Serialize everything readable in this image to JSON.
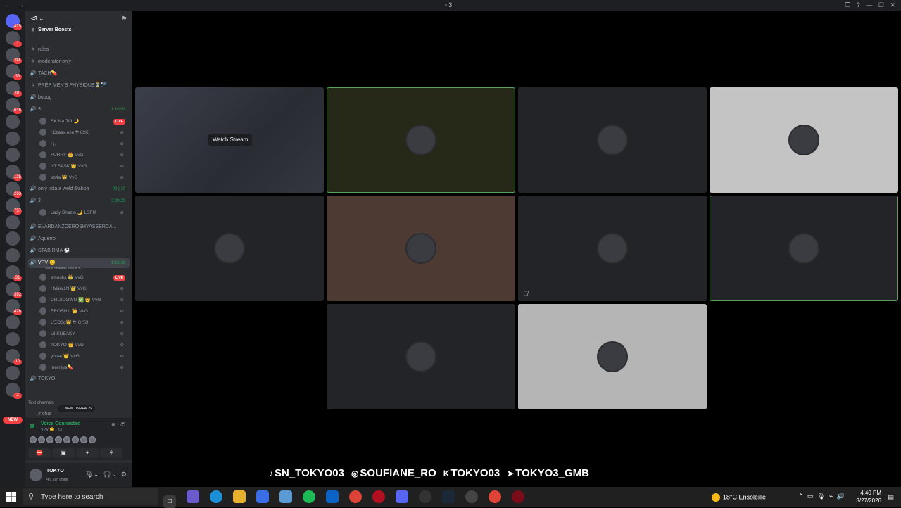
{
  "titlebar": {
    "title": "<3",
    "nav": "← →",
    "window_controls": "❐ ? — ☐ ✕"
  },
  "servers": [
    {
      "badge": "475"
    },
    {
      "badge": "1"
    },
    {
      "badge": "99"
    },
    {
      "badge": "33"
    },
    {
      "badge": "91"
    },
    {
      "badge": "546"
    },
    {
      "badge": ""
    },
    {
      "badge": ""
    },
    {
      "badge": ""
    },
    {
      "badge": "125"
    },
    {
      "badge": "263"
    },
    {
      "badge": "757"
    },
    {
      "badge": ""
    },
    {
      "badge": ""
    },
    {
      "badge": ""
    },
    {
      "badge": "31"
    },
    {
      "badge": "392"
    },
    {
      "badge": "426"
    },
    {
      "badge": ""
    },
    {
      "badge": ""
    },
    {
      "badge": "10"
    },
    {
      "badge": ""
    },
    {
      "badge": "2"
    }
  ],
  "new_pill": "NEW",
  "guild": {
    "name": "<3 ⌄",
    "boosts": "Server Boosts"
  },
  "channels": [
    {
      "icon": "#",
      "name": "rules"
    },
    {
      "icon": "#",
      "name": "moderator-only"
    },
    {
      "icon": "🔊",
      "name": "TACH💊"
    },
    {
      "icon": "#",
      "name": "PRÉP MEN'S PHYSIQUE⏳🏸"
    },
    {
      "icon": "🔊",
      "name": "booog"
    },
    {
      "icon": "🔊",
      "name": "3",
      "time": "1:10:02"
    }
  ],
  "ch3_users": [
    {
      "name": "SK.NAITO 🌙",
      "live": "LIVE"
    },
    {
      "name": "! £zaax.exe ⛈ 82K"
    },
    {
      "name": "! ¡₉"
    },
    {
      "name": "FURRY 👑 VvG"
    },
    {
      "name": "NT.SASK 👑 VvG"
    },
    {
      "name": "sb4a 👑 VvG"
    }
  ],
  "channels2": [
    {
      "icon": "🔊",
      "name": "only lista a weld l9ahba",
      "time": "00 | 10"
    },
    {
      "icon": "🔊",
      "name": "2",
      "time": "3:29:23"
    }
  ],
  "ch2_users": [
    {
      "name": "Lady Shazia 🌙 LSFM"
    }
  ],
  "channels3": [
    {
      "icon": "🔊",
      "name": "EVARDANZOEROSHYASSERCA..."
    },
    {
      "icon": "🔊",
      "name": "Aguerro"
    },
    {
      "icon": "🔊",
      "name": "STAB RMA ⚽"
    },
    {
      "icon": "🔊",
      "name": "VPV 😊",
      "time": "1:18:39",
      "status": "Set a channel status ✎"
    }
  ],
  "vpv_users": [
    {
      "name": "smooks 👑 VvG",
      "live": "LIVE"
    },
    {
      "name": "! Märv1N 👑 VvG"
    },
    {
      "name": "CRL8DOWN ✅ 👑 VvG"
    },
    {
      "name": "EROSH !! 👑 VvG"
    },
    {
      "name": "L'ΞΟβα👑 ⛈ G°59"
    },
    {
      "name": "Lil SNEAKY"
    },
    {
      "name": "TOKYO 👑 VvG"
    },
    {
      "name": "ylттər 👑 VvG"
    },
    {
      "name": "merniga💊"
    }
  ],
  "channels4": [
    {
      "icon": "🔊",
      "name": "TOKYO"
    }
  ],
  "text_channels_label": "Text channels",
  "chat_label": "# chat",
  "new_unreads": "⌄ NEW UNREADS",
  "voice": {
    "status": "Voice Connected",
    "sub": "VPV 😊 / <3",
    "controls": "≡ ✆"
  },
  "voice_buttons": [
    "⛔",
    "▣",
    "✦",
    "⚘"
  ],
  "user": {
    "name": "TOKYO",
    "sub": "•ɐ༉ kan chafk ˘˘",
    "controls": "🎙⌄ 🎧⌄ ⚙"
  },
  "watch_stream": "Watch Stream",
  "social": [
    {
      "icon": "♪",
      "handle": "SN_TOKYO03"
    },
    {
      "icon": "◎",
      "handle": "SOUFIANE_RO"
    },
    {
      "icon": "K",
      "handle": "TOKYO03"
    },
    {
      "icon": "➤",
      "handle": "TOKYO3_GMB"
    }
  ],
  "taskbar": {
    "search_placeholder": "Type here to search",
    "weather": "18°C  Ensoleillé",
    "systray": "⌃ ▭ 🎙 ⌁ 🔊",
    "time": "4:40 PM",
    "date": "3/27/2026"
  },
  "tile_colors": {
    "speaking": "#5ba35b",
    "brown": "#4d3a33",
    "olive": "#262818",
    "light": "#c4c4c4",
    "tan": "#b5b5b5"
  }
}
